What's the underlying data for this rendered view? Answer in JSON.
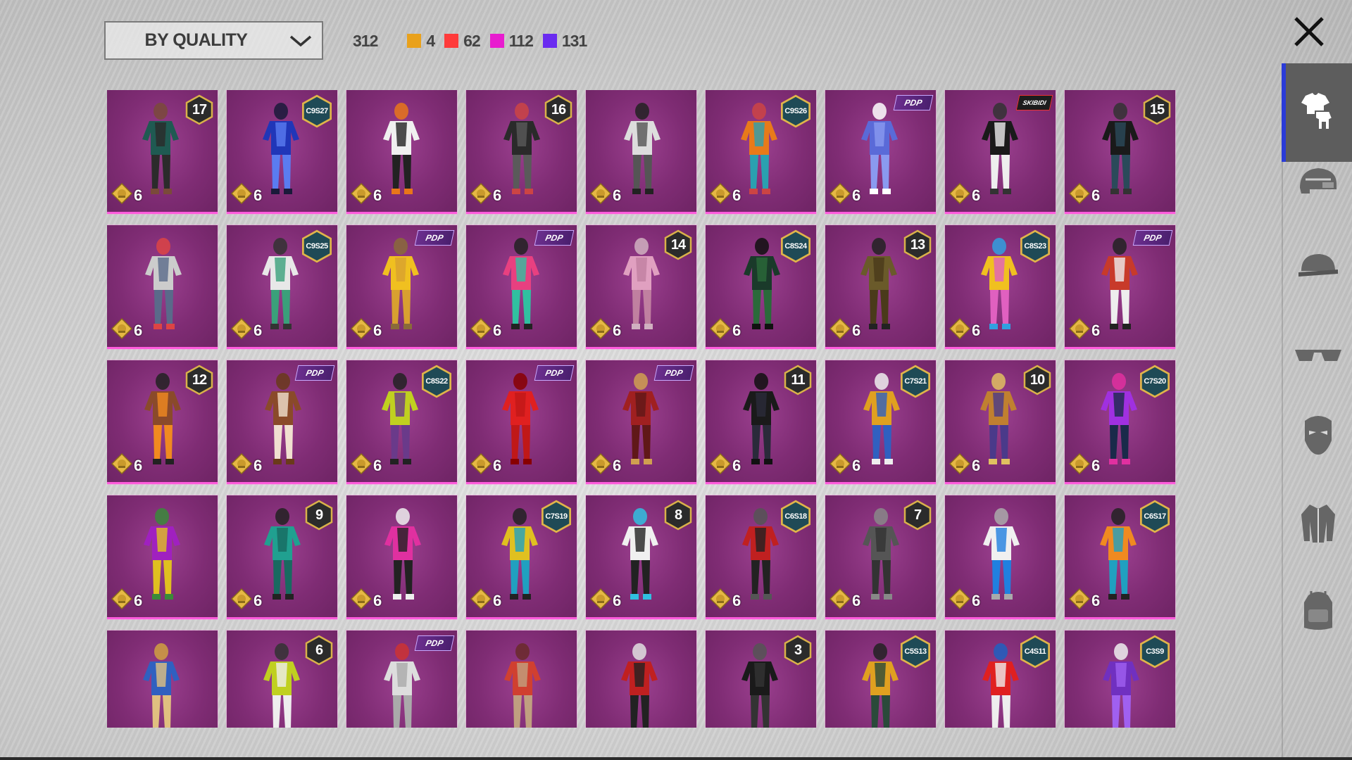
{
  "sort": {
    "label": "BY QUALITY"
  },
  "counts": {
    "total": "312",
    "qualities": [
      {
        "color": "#e9a11c",
        "count": "4"
      },
      {
        "color": "#ff3b3b",
        "count": "62"
      },
      {
        "color": "#e81ccf",
        "count": "112"
      },
      {
        "color": "#6a2bf0",
        "count": "131"
      }
    ]
  },
  "close_icon": "close-icon",
  "sidebar": [
    {
      "icon": "outfit-icon",
      "active": true
    },
    {
      "icon": "helmet-icon",
      "active": false
    },
    {
      "icon": "cap-icon",
      "active": false
    },
    {
      "icon": "glasses-icon",
      "active": false
    },
    {
      "icon": "mask-icon",
      "active": false
    },
    {
      "icon": "jacket-icon",
      "active": false
    },
    {
      "icon": "backpack-icon",
      "active": false
    }
  ],
  "items": [
    {
      "badge_type": "level",
      "badge": "17",
      "value": "6",
      "palette": [
        "#1f5a52",
        "#2b2b2b",
        "#7a4a3a"
      ]
    },
    {
      "badge_type": "season",
      "badge": "C9S27",
      "value": "6",
      "palette": [
        "#2036b8",
        "#5a7cf0",
        "#1a1a3a"
      ]
    },
    {
      "badge_type": "none",
      "badge": "",
      "value": "6",
      "palette": [
        "#f0f0f0",
        "#222",
        "#e8761a"
      ]
    },
    {
      "badge_type": "level",
      "badge": "16",
      "value": "6",
      "palette": [
        "#2a2a2a",
        "#5a5a5a",
        "#c44"
      ]
    },
    {
      "badge_type": "none",
      "badge": "",
      "value": "6",
      "palette": [
        "#ddd",
        "#555",
        "#222"
      ]
    },
    {
      "badge_type": "season",
      "badge": "C9S26",
      "value": "6",
      "palette": [
        "#e87a1a",
        "#2aa0b0",
        "#c44"
      ]
    },
    {
      "badge_type": "pill",
      "badge": "PDP",
      "value": "6",
      "palette": [
        "#5a6ad8",
        "#8a9af0",
        "#fff"
      ]
    },
    {
      "badge_type": "pill-red",
      "badge": "SKIBIDI",
      "value": "6",
      "palette": [
        "#1a1a1a",
        "#eee",
        "#333"
      ]
    },
    {
      "badge_type": "level",
      "badge": "15",
      "value": "6",
      "palette": [
        "#1a1a1a",
        "#2a4a5a",
        "#333"
      ]
    },
    {
      "badge_type": "none",
      "badge": "",
      "value": "6",
      "palette": [
        "#ccc",
        "#5a6a8a",
        "#d44"
      ]
    },
    {
      "badge_type": "season",
      "badge": "C9S25",
      "value": "6",
      "palette": [
        "#e8e8e8",
        "#3aa07a",
        "#333"
      ]
    },
    {
      "badge_type": "pill",
      "badge": "PDP",
      "value": "6",
      "palette": [
        "#f0c020",
        "#d8a030",
        "#8a6a3a"
      ]
    },
    {
      "badge_type": "pill",
      "badge": "PDP",
      "value": "6",
      "palette": [
        "#e84080",
        "#30c0a0",
        "#222"
      ]
    },
    {
      "badge_type": "level",
      "badge": "14",
      "value": "6",
      "palette": [
        "#e0a0c0",
        "#c080a0",
        "#d0b0c0"
      ]
    },
    {
      "badge_type": "season",
      "badge": "C8S24",
      "value": "6",
      "palette": [
        "#1a3a2a",
        "#2a6a3a",
        "#111"
      ]
    },
    {
      "badge_type": "level",
      "badge": "13",
      "value": "6",
      "palette": [
        "#6a5a2a",
        "#4a3a1a",
        "#222"
      ]
    },
    {
      "badge_type": "season",
      "badge": "C8S23",
      "value": "6",
      "palette": [
        "#f0c020",
        "#e060c0",
        "#30a0e0"
      ]
    },
    {
      "badge_type": "pill",
      "badge": "PDP",
      "value": "6",
      "palette": [
        "#c83a2a",
        "#eee",
        "#222"
      ]
    },
    {
      "badge_type": "level",
      "badge": "12",
      "value": "6",
      "palette": [
        "#8a4a2a",
        "#f08a20",
        "#222"
      ]
    },
    {
      "badge_type": "pill",
      "badge": "PDP",
      "value": "6",
      "palette": [
        "#8a4a2a",
        "#f0e0d0",
        "#6a3a1a"
      ]
    },
    {
      "badge_type": "season",
      "badge": "C8S22",
      "value": "6",
      "palette": [
        "#c0d020",
        "#6a3a8a",
        "#222"
      ]
    },
    {
      "badge_type": "pill",
      "badge": "PDP",
      "value": "6",
      "palette": [
        "#e02020",
        "#c01818",
        "#800"
      ]
    },
    {
      "badge_type": "pill",
      "badge": "PDP",
      "value": "6",
      "palette": [
        "#a02020",
        "#601818",
        "#d0a050"
      ]
    },
    {
      "badge_type": "level",
      "badge": "11",
      "value": "6",
      "palette": [
        "#1a1a1a",
        "#2a2a3a",
        "#111"
      ]
    },
    {
      "badge_type": "season",
      "badge": "C7S21",
      "value": "6",
      "palette": [
        "#e0a020",
        "#3060c0",
        "#eee"
      ]
    },
    {
      "badge_type": "level",
      "badge": "10",
      "value": "6",
      "palette": [
        "#c08030",
        "#4a3a8a",
        "#e0c060"
      ]
    },
    {
      "badge_type": "season",
      "badge": "C7S20",
      "value": "6",
      "palette": [
        "#a030e0",
        "#1a2a4a",
        "#e030a0"
      ]
    },
    {
      "badge_type": "none",
      "badge": "",
      "value": "6",
      "palette": [
        "#a020c0",
        "#e0c020",
        "#3a8a3a"
      ]
    },
    {
      "badge_type": "level",
      "badge": "9",
      "value": "6",
      "palette": [
        "#20a090",
        "#186a60",
        "#222"
      ]
    },
    {
      "badge_type": "none",
      "badge": "",
      "value": "6",
      "palette": [
        "#e030a0",
        "#222",
        "#eee"
      ]
    },
    {
      "badge_type": "season",
      "badge": "C7S19",
      "value": "6",
      "palette": [
        "#e0c020",
        "#20a0c0",
        "#222"
      ]
    },
    {
      "badge_type": "level",
      "badge": "8",
      "value": "6",
      "palette": [
        "#f0f0f0",
        "#222",
        "#30c0e0"
      ]
    },
    {
      "badge_type": "season",
      "badge": "C6S18",
      "value": "6",
      "palette": [
        "#c02020",
        "#222",
        "#555"
      ]
    },
    {
      "badge_type": "level",
      "badge": "7",
      "value": "6",
      "palette": [
        "#555",
        "#333",
        "#888"
      ]
    },
    {
      "badge_type": "none",
      "badge": "",
      "value": "6",
      "palette": [
        "#f0f0f0",
        "#2080e0",
        "#aaa"
      ]
    },
    {
      "badge_type": "season",
      "badge": "C6S17",
      "value": "6",
      "palette": [
        "#f08a20",
        "#20a0c0",
        "#222"
      ]
    },
    {
      "badge_type": "none",
      "badge": "",
      "value": "",
      "palette": [
        "#3060c0",
        "#e0c080",
        "#d0a040"
      ]
    },
    {
      "badge_type": "level",
      "badge": "6",
      "value": "",
      "palette": [
        "#c0d020",
        "#eee",
        "#333"
      ]
    },
    {
      "badge_type": "pill",
      "badge": "PDP",
      "value": "",
      "palette": [
        "#ddd",
        "#aaa",
        "#c33"
      ]
    },
    {
      "badge_type": "none",
      "badge": "",
      "value": "",
      "palette": [
        "#d04030",
        "#c0a080",
        "#6a2a2a"
      ]
    },
    {
      "badge_type": "none",
      "badge": "",
      "value": "",
      "palette": [
        "#c02020",
        "#222",
        "#e0e0e0"
      ]
    },
    {
      "badge_type": "level",
      "badge": "3",
      "value": "",
      "palette": [
        "#1a1a1a",
        "#333",
        "#555"
      ]
    },
    {
      "badge_type": "season",
      "badge": "C5S13",
      "value": "",
      "palette": [
        "#e0a020",
        "#2a4a3a",
        "#222"
      ]
    },
    {
      "badge_type": "season",
      "badge": "C4S11",
      "value": "",
      "palette": [
        "#e02020",
        "#eee",
        "#2060c0"
      ]
    },
    {
      "badge_type": "season",
      "badge": "C3S9",
      "value": "",
      "palette": [
        "#7030c0",
        "#a060f0",
        "#eee"
      ]
    }
  ]
}
